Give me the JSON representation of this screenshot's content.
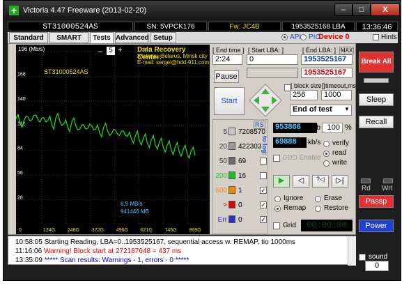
{
  "titlebar": {
    "title": "Victoria 4.47  Freeware (2013-02-20)",
    "min": "–",
    "max": "□",
    "close": "X",
    "app_icon": "plus-icon"
  },
  "info": {
    "model": "ST31000524AS",
    "serial": "SN: 5VPCK176",
    "firmware": "Fw: JC4B",
    "lba": "1953525168 LBA (~931 GB)",
    "clock": "13:36:46"
  },
  "tabs": [
    "Standard",
    "SMART",
    "Tests",
    "Advanced",
    "Setup"
  ],
  "api": {
    "api_label": "API",
    "pio_label": "PIO",
    "device": "Device 0",
    "hints_label": "Hints"
  },
  "graph": {
    "unit": "196 (Mb/s)",
    "zoom_minus": "–",
    "zoom_value": "5",
    "zoom_plus": "+",
    "drive_label": "ST31000524AS",
    "promo_line1": "Data Recovery Center:",
    "promo_line2": "'Victoria', Belarus, Minsk city",
    "promo_line3": "E-mail: sergei@hdd-911.com",
    "speed_label": "6,9 MB/s",
    "size_label": "941446 MB",
    "y_ticks": [
      "196",
      "168",
      "140",
      "112",
      "84",
      "56",
      "28"
    ],
    "x_ticks": [
      "0",
      "124G",
      "248G",
      "372G",
      "496G",
      "621G",
      "745G",
      "869G"
    ]
  },
  "chart_data": {
    "type": "line",
    "ylim": [
      0,
      196
    ],
    "xlim": [
      0,
      931
    ],
    "x": [
      0,
      20,
      40,
      60,
      80,
      100,
      120,
      140,
      160,
      180,
      200,
      220,
      240,
      260,
      280,
      300,
      320,
      340,
      360,
      380,
      400,
      420,
      440,
      460,
      480,
      500,
      520,
      540,
      560,
      580,
      600,
      620,
      640,
      660,
      680,
      700,
      720,
      740,
      760,
      780,
      800,
      820,
      840,
      860,
      880,
      900
    ],
    "y": [
      120,
      115,
      118,
      122,
      119,
      124,
      116,
      121,
      118,
      113,
      121,
      117,
      114,
      110,
      116,
      112,
      108,
      113,
      109,
      112,
      108,
      104,
      110,
      106,
      103,
      107,
      101,
      106,
      100,
      97,
      101,
      95,
      98,
      92,
      96,
      90,
      93,
      87,
      90,
      84,
      88,
      82,
      85,
      80,
      83,
      78
    ]
  },
  "controls": {
    "end_time_label": "[ End time ]",
    "end_time_value": "2:24",
    "start_lba_label": "[ Start LBA: ]",
    "start_lba_value": "0",
    "end_lba_label": "[ End LBA: ]",
    "end_lba_max": "MAX",
    "end_lba_value": "1953525167",
    "end_lba_value2": "1953525167",
    "pause_label": "Pause",
    "start_label": "Start",
    "block_size_label": "[ block size ]",
    "block_size_value": "256",
    "timeout_label": "[ timeout,ms ]",
    "timeout_value": "1000",
    "end_mode": "End of test",
    "rs_label": "RS",
    "to_log_label": "to log:"
  },
  "blocks": [
    {
      "label": "5",
      "count": "7208570",
      "color": "#c8c8c8"
    },
    {
      "label": "20",
      "count": "422303",
      "color": "#9a9a9a"
    },
    {
      "label": "50",
      "count": "69",
      "color": "#6a6a6a"
    },
    {
      "label": "200",
      "count": "16",
      "color": "#19c419"
    },
    {
      "label": "600",
      "count": "1",
      "color": "#f08a00"
    },
    {
      "label": ">",
      "count": "0",
      "color": "#e00000"
    },
    {
      "label": "Err",
      "count": "0",
      "color": "#2233cc"
    }
  ],
  "progress": {
    "mb": "953866",
    "mb_unit": "Mb",
    "percent": "100",
    "percent_unit": "%",
    "kbs": "69888",
    "kbs_unit": "kb/s",
    "ddd_enable": "DDD Enable",
    "verify": "verify",
    "read": "read",
    "write": "write",
    "ignore": "Ignore",
    "erase": "Erase",
    "remap": "Remap",
    "restore": "Restore",
    "grid": "Grid",
    "timer": "00:00:00"
  },
  "right": {
    "break_all": "Break All",
    "sleep": "Sleep",
    "recall": "Recall",
    "rd": "Rd",
    "wrt": "Wrt",
    "passp": "Passp",
    "power": "Power",
    "sound": "sound",
    "sound_value": "0"
  },
  "log": [
    {
      "time": "10:58:05",
      "text": "Starting Reading, LBA=0..1953525167, sequential access w. REMAP, tio 1000ms",
      "color": "#000000"
    },
    {
      "time": "11:16:06",
      "text": "Warning! Block start at 272187648 = 437 ms",
      "color": "#e00000"
    },
    {
      "time": "13:35:09",
      "text": "***** Scan results: Warnings - 1, errors - 0 *****",
      "color": "#0000cc"
    }
  ]
}
